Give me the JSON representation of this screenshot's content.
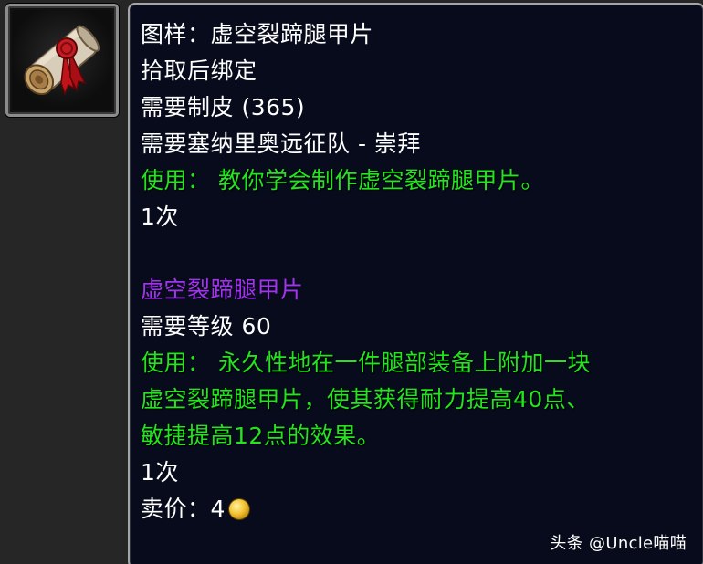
{
  "item_icon": {
    "icon": "recipe-scroll-icon"
  },
  "tooltip": {
    "title": "图样：虚空裂蹄腿甲片",
    "bind_type": "拾取后绑定",
    "req_skill": "需要制皮 (365)",
    "req_rep": "需要塞纳里奥远征队 - 崇拜",
    "use_text": "使用：  教你学会制作虚空裂蹄腿甲片。",
    "charges_1": "1次",
    "created_item_name": "虚空裂蹄腿甲片",
    "req_level": "需要等级 60",
    "use_line_1": "使用：  永久性地在一件腿部装备上附加一块",
    "use_line_2": "虚空裂蹄腿甲片，使其获得耐力提高40点、",
    "use_line_3": "敏捷提高12点的效果。",
    "charges_2": "1次",
    "sell_label": "卖价：",
    "sell_value": "4",
    "coin_icon": "gold-coin-icon"
  },
  "colors": {
    "title_white": "#ffffff",
    "use_green": "#23e41f",
    "epic_purple": "#a334ee",
    "tooltip_bg": "#070b1b"
  },
  "watermark": "头条 @Uncle喵喵"
}
